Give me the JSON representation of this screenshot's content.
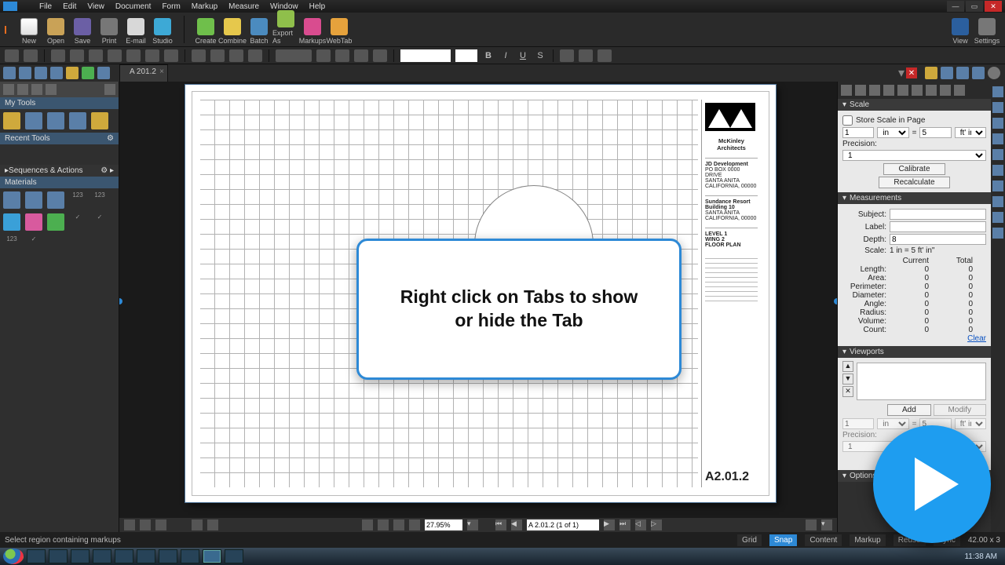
{
  "menus": [
    "File",
    "Edit",
    "View",
    "Document",
    "Form",
    "Markup",
    "Measure",
    "Window",
    "Help"
  ],
  "ribbon": {
    "new": "New",
    "open": "Open",
    "save": "Save",
    "print": "Print",
    "email": "E-mail",
    "studio": "Studio",
    "create": "Create",
    "combine": "Combine",
    "batch": "Batch",
    "exportas": "Export As",
    "markups": "Markups",
    "webtab": "WebTab",
    "view": "View",
    "settings": "Settings"
  },
  "doc_tab": "A 201.2",
  "left": {
    "mytools": "My Tools",
    "recent": "Recent Tools",
    "sequences": "Sequences & Actions",
    "materials": "Materials",
    "label123": "123"
  },
  "callout_line1": "Right click on Tabs to show",
  "callout_line2": "or hide the Tab",
  "titleblock": {
    "arch": "McKinley Architects",
    "client": "JD Development",
    "addr1": "PO BOX 0000 DRIVE",
    "addr2": "SANTA ANITA",
    "addr3": "CALIFORNIA, 00000",
    "proj1": "Sundance Resort",
    "proj2": "Building 10",
    "proj3": "SANTA ANITA",
    "proj4": "CALIFORNIA, 00000",
    "view1": "LEVEL 1",
    "view2": "WING 2",
    "view3": "FLOOR PLAN",
    "sheet": "A2.01.2"
  },
  "docbar": {
    "zoom": "27.95%",
    "page": "A 2.01.2 (1 of 1)"
  },
  "right": {
    "scale_head": "Scale",
    "store": "Store Scale in Page",
    "one": "1",
    "in": "in",
    "eq": "=",
    "five": "5",
    "ftin": "ft' in\"",
    "precision": "Precision:",
    "prec_val": "1",
    "calibrate": "Calibrate",
    "recalculate": "Recalculate",
    "meas_head": "Measurements",
    "subject": "Subject:",
    "label": "Label:",
    "depth": "Depth:",
    "depth_val": "8",
    "scale": "Scale:",
    "scale_val": "1 in = 5 ft' in\"",
    "current": "Current",
    "total": "Total",
    "length": "Length:",
    "area": "Area:",
    "perimeter": "Perimeter:",
    "diameter": "Diameter:",
    "angle": "Angle:",
    "radius": "Radius:",
    "volume": "Volume:",
    "count": "Count:",
    "zero": "0",
    "clear": "Clear",
    "vp_head": "Viewports",
    "add": "Add",
    "modify": "Modify",
    "opts_head": "Options"
  },
  "status": {
    "msg": "Select region containing markups",
    "grid": "Grid",
    "snap": "Snap",
    "content": "Content",
    "markup": "Markup",
    "reuse": "Reuse",
    "sync": "Sync",
    "coords": "42.00 x 3",
    "time": "11:38 AM"
  }
}
